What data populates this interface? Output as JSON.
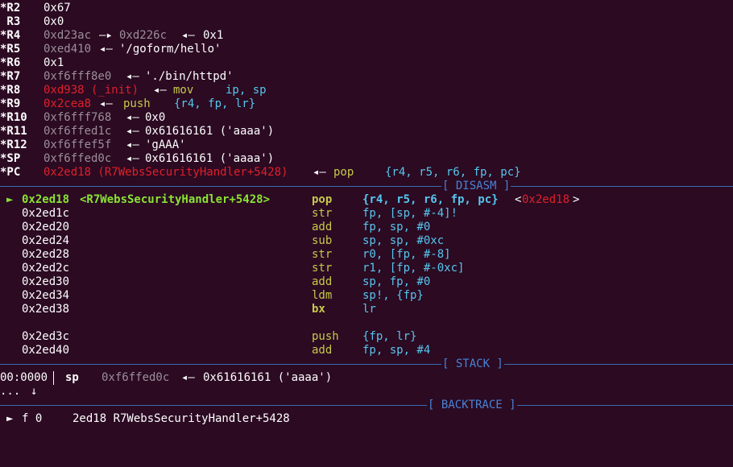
{
  "colors": {
    "background": "#2b0a22",
    "text": "#ffffff",
    "address_dim": "#9c8f9a",
    "code_pointer": "#e0202a",
    "operands": "#56c6ee",
    "mnemonic": "#c7c94b",
    "current_line": "#8ae234",
    "separator": "#4a82d4"
  },
  "registers": [
    {
      "name": "*R2",
      "value": "0x67"
    },
    {
      "name": " R3",
      "value": "0x0"
    },
    {
      "name": "*R4",
      "value": "0xd23ac",
      "arrow1": "—▸",
      "deref1": "0xd226c",
      "arrow2": "◂—",
      "deref2": "0x1"
    },
    {
      "name": "*R5",
      "value": "0xed410",
      "arrow1": "◂—",
      "deref1": "'/goform/hello'"
    },
    {
      "name": "*R6",
      "value": "0x1"
    },
    {
      "name": "*R7",
      "value": "0xf6fff8e0",
      "arrow1": "◂—",
      "deref1": "'./bin/httpd'"
    },
    {
      "name": "*R8",
      "value": "0xd938 (_init)",
      "arrow1": "◂—",
      "deref1": "mov",
      "deref2": "ip, sp"
    },
    {
      "name": "*R9",
      "value": "0x2cea8",
      "arrow1": "◂—",
      "deref1": "push",
      "deref2": "{r4, fp, lr}"
    },
    {
      "name": "*R10",
      "value": "0xf6fff768",
      "arrow1": "◂—",
      "deref1": "0x0"
    },
    {
      "name": "*R11",
      "value": "0xf6ffed1c",
      "arrow1": "◂—",
      "deref1": "0x61616161 ('aaaa')"
    },
    {
      "name": "*R12",
      "value": "0xf6ffef5f",
      "arrow1": "◂—",
      "deref1": "'gAAA'"
    },
    {
      "name": "*SP",
      "value": "0xf6ffed0c",
      "arrow1": "◂—",
      "deref1": "0x61616161 ('aaaa')"
    },
    {
      "name": "*PC",
      "value": "0x2ed18 (R7WebsSecurityHandler+5428)",
      "arrow1": "◂—",
      "deref1": "pop",
      "deref2": "{r4, r5, r6, fp, pc}"
    }
  ],
  "sections": {
    "disasm": "[ DISASM ]",
    "stack": "[ STACK ]",
    "backtrace": "[ BACKTRACE ]"
  },
  "disasm": {
    "current_marker": "►",
    "lines": [
      {
        "addr": "0x2ed18",
        "symbol": "<R7WebsSecurityHandler+5428>",
        "mnemonic": "pop",
        "operands": "{r4, r5, r6, fp, pc}",
        "open": "<",
        "target": "0x2ed18",
        "close": ">"
      },
      {
        "addr": "0x2ed1c",
        "mnemonic": "str",
        "operands": "fp, [sp, #-4]!"
      },
      {
        "addr": "0x2ed20",
        "mnemonic": "add",
        "operands": "fp, sp, #0"
      },
      {
        "addr": "0x2ed24",
        "mnemonic": "sub",
        "operands": "sp, sp, #0xc"
      },
      {
        "addr": "0x2ed28",
        "mnemonic": "str",
        "operands": "r0, [fp, #-8]"
      },
      {
        "addr": "0x2ed2c",
        "mnemonic": "str",
        "operands": "r1, [fp, #-0xc]"
      },
      {
        "addr": "0x2ed30",
        "mnemonic": "add",
        "operands": "sp, fp, #0"
      },
      {
        "addr": "0x2ed34",
        "mnemonic": "ldm",
        "operands": "sp!, {fp}"
      },
      {
        "addr": "0x2ed38",
        "mnemonic": "bx",
        "operands": "lr"
      },
      {
        "addr": "0x2ed3c",
        "mnemonic": "push",
        "operands": "{fp, lr}"
      },
      {
        "addr": "0x2ed40",
        "mnemonic": "add",
        "operands": "fp, sp, #4"
      }
    ]
  },
  "stack": [
    {
      "offset": "00:0000",
      "reg": "sp",
      "addr": "0xf6ffed0c",
      "arrow": "◂—",
      "deref": "0x61616161 ('aaaa')"
    }
  ],
  "stack_more": {
    "dots": "...",
    "arrow": "↓"
  },
  "backtrace": [
    {
      "marker": "►",
      "frame": "f 0",
      "location": "2ed18 R7WebsSecurityHandler+5428"
    }
  ]
}
